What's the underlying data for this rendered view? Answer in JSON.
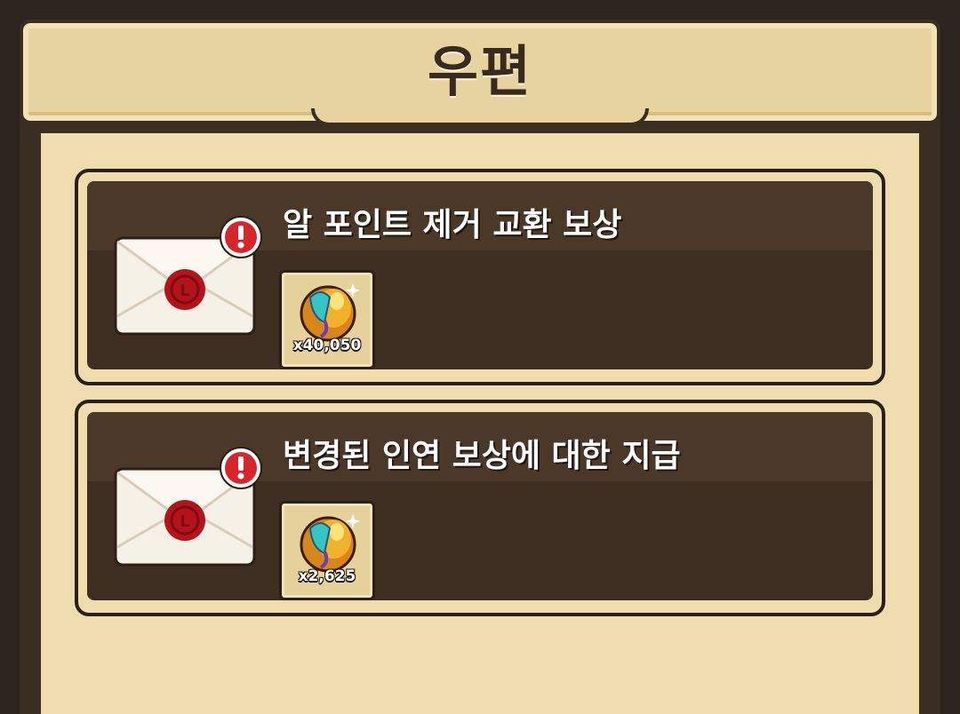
{
  "header": {
    "title": "우편"
  },
  "mails": [
    {
      "title": "알 포인트 제거 교환 보상",
      "reward": {
        "icon": "gold-egg-icon",
        "quantity": "x40,050"
      }
    },
    {
      "title": "변경된 인연 보상에 대한 지급",
      "reward": {
        "icon": "gold-egg-icon",
        "quantity": "x2,625"
      }
    }
  ],
  "colors": {
    "panel": "#ecdcae",
    "card": "#3d2e21",
    "alert": "#d6262b",
    "seal": "#b3141b"
  }
}
